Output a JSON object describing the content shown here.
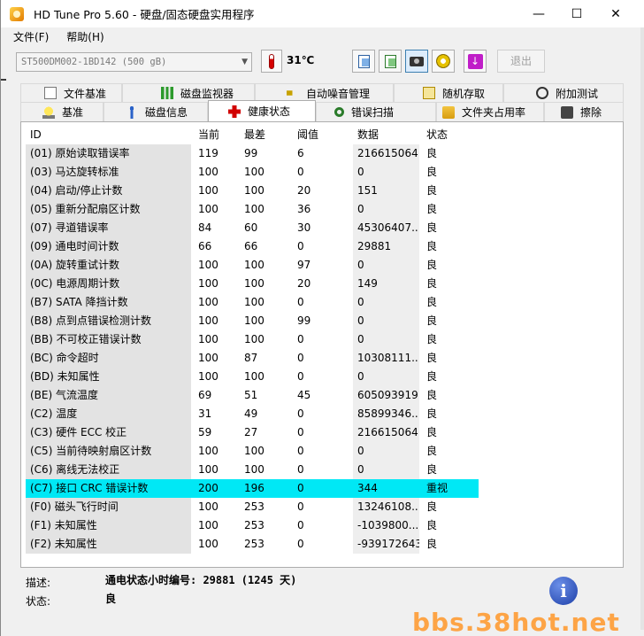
{
  "window": {
    "title": "HD Tune Pro 5.60 - 硬盘/固态硬盘实用程序",
    "minimize": "—",
    "maximize": "☐",
    "close": "✕"
  },
  "menu": [
    "文件(F)",
    "帮助(H)"
  ],
  "toolbar": {
    "drive": "ST500DM002-1BD142 (500 gB)",
    "temperature": "31℃",
    "exit_label": "退出"
  },
  "tabs_row1": [
    {
      "label": "文件基准",
      "icon": "doc-icon"
    },
    {
      "label": "磁盘监视器",
      "icon": "bar-chart-icon"
    },
    {
      "label": "自动噪音管理",
      "icon": "speaker-icon"
    },
    {
      "label": "随机存取",
      "icon": "dice-icon"
    },
    {
      "label": "附加测试",
      "icon": "stopwatch-icon"
    }
  ],
  "tabs_row2": [
    {
      "label": "基准",
      "icon": "bulb-icon"
    },
    {
      "label": "磁盘信息",
      "icon": "info-icon"
    },
    {
      "label": "健康状态",
      "icon": "cross-icon"
    },
    {
      "label": "错误扫描",
      "icon": "magnifier-icon"
    },
    {
      "label": "文件夹占用率",
      "icon": "folder-icon"
    },
    {
      "label": "擦除",
      "icon": "eraser-icon"
    }
  ],
  "selected_tab": "健康状态",
  "table": {
    "headers": [
      "ID",
      "当前",
      "最差",
      "阈值",
      "数据",
      "状态"
    ],
    "rows": [
      {
        "id": "(01) 原始读取错误率",
        "cur": "119",
        "worst": "99",
        "thr": "6",
        "data": "216615064",
        "stat": "良"
      },
      {
        "id": "(03) 马达旋转标准",
        "cur": "100",
        "worst": "100",
        "thr": "0",
        "data": "0",
        "stat": "良"
      },
      {
        "id": "(04) 启动/停止计数",
        "cur": "100",
        "worst": "100",
        "thr": "20",
        "data": "151",
        "stat": "良"
      },
      {
        "id": "(05) 重新分配扇区计数",
        "cur": "100",
        "worst": "100",
        "thr": "36",
        "data": "0",
        "stat": "良"
      },
      {
        "id": "(07) 寻道错误率",
        "cur": "84",
        "worst": "60",
        "thr": "30",
        "data": "45306407...",
        "stat": "良"
      },
      {
        "id": "(09) 通电时间计数",
        "cur": "66",
        "worst": "66",
        "thr": "0",
        "data": "29881",
        "stat": "良"
      },
      {
        "id": "(0A) 旋转重试计数",
        "cur": "100",
        "worst": "100",
        "thr": "97",
        "data": "0",
        "stat": "良"
      },
      {
        "id": "(0C) 电源周期计数",
        "cur": "100",
        "worst": "100",
        "thr": "20",
        "data": "149",
        "stat": "良"
      },
      {
        "id": "(B7) SATA 降挡计数",
        "cur": "100",
        "worst": "100",
        "thr": "0",
        "data": "0",
        "stat": "良"
      },
      {
        "id": "(B8) 点到点错误检测计数",
        "cur": "100",
        "worst": "100",
        "thr": "99",
        "data": "0",
        "stat": "良"
      },
      {
        "id": "(BB) 不可校正错误计数",
        "cur": "100",
        "worst": "100",
        "thr": "0",
        "data": "0",
        "stat": "良"
      },
      {
        "id": "(BC) 命令超时",
        "cur": "100",
        "worst": "87",
        "thr": "0",
        "data": "10308111...",
        "stat": "良"
      },
      {
        "id": "(BD) 未知属性",
        "cur": "100",
        "worst": "100",
        "thr": "0",
        "data": "0",
        "stat": "良"
      },
      {
        "id": "(BE) 气流温度",
        "cur": "69",
        "worst": "51",
        "thr": "45",
        "data": "605093919",
        "stat": "良"
      },
      {
        "id": "(C2) 温度",
        "cur": "31",
        "worst": "49",
        "thr": "0",
        "data": "85899346...",
        "stat": "良"
      },
      {
        "id": "(C3) 硬件 ECC 校正",
        "cur": "59",
        "worst": "27",
        "thr": "0",
        "data": "216615064",
        "stat": "良"
      },
      {
        "id": "(C5) 当前待映射扇区计数",
        "cur": "100",
        "worst": "100",
        "thr": "0",
        "data": "0",
        "stat": "良"
      },
      {
        "id": "(C6) 离线无法校正",
        "cur": "100",
        "worst": "100",
        "thr": "0",
        "data": "0",
        "stat": "良"
      },
      {
        "id": "(C7) 接口 CRC 错误计数",
        "cur": "200",
        "worst": "196",
        "thr": "0",
        "data": "344",
        "stat": "重视",
        "highlight": true
      },
      {
        "id": "(F0) 磁头飞行时间",
        "cur": "100",
        "worst": "253",
        "thr": "0",
        "data": "13246108...",
        "stat": "良"
      },
      {
        "id": "(F1) 未知属性",
        "cur": "100",
        "worst": "253",
        "thr": "0",
        "data": "-1039800...",
        "stat": "良"
      },
      {
        "id": "(F2) 未知属性",
        "cur": "100",
        "worst": "253",
        "thr": "0",
        "data": "-939172643",
        "stat": "良"
      }
    ]
  },
  "footer": {
    "desc_label": "描述:",
    "desc_value": "通电状态小时编号: 29881 (1245 天)",
    "status_label": "状态:",
    "status_value": "良",
    "info_glyph": "i"
  },
  "watermark": "bbs.38hot.net",
  "colors": {
    "highlight": "#00e8f5"
  }
}
